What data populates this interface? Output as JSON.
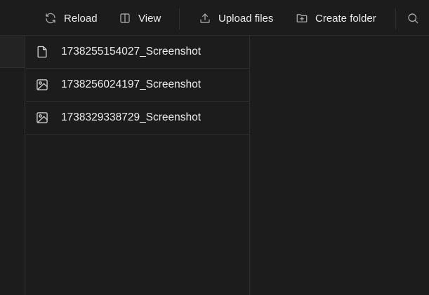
{
  "toolbar": {
    "reload_label": "Reload",
    "view_label": "View",
    "upload_label": "Upload files",
    "create_folder_label": "Create folder",
    "icons": [
      "reload-icon",
      "columns-icon",
      "upload-icon",
      "folder-plus-icon",
      "search-icon"
    ]
  },
  "files": [
    {
      "name": "1738255154027_Screenshot",
      "icon": "file-icon"
    },
    {
      "name": "1738256024197_Screenshot",
      "icon": "image-icon"
    },
    {
      "name": "1738329338729_Screenshot",
      "icon": "image-icon"
    }
  ],
  "colors": {
    "background": "#1c1c1c",
    "text": "#ededed",
    "border": "#2e2e2e",
    "icon": "#b4b4b4"
  }
}
